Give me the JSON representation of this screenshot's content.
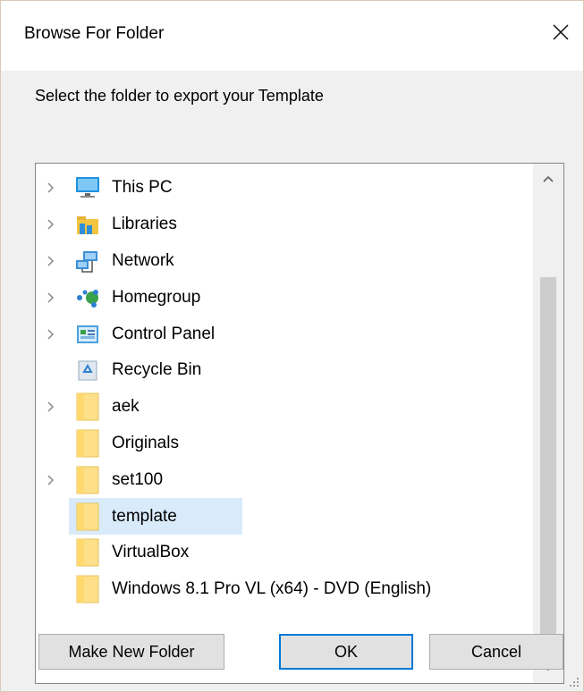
{
  "window": {
    "title": "Browse For Folder",
    "close_icon": "close-icon"
  },
  "prompt": "Select the folder to export your Template",
  "tree": {
    "items": [
      {
        "label": "This PC",
        "icon": "computer-icon",
        "expandable": true,
        "selected": false
      },
      {
        "label": "Libraries",
        "icon": "libraries-icon",
        "expandable": true,
        "selected": false
      },
      {
        "label": "Network",
        "icon": "network-icon",
        "expandable": true,
        "selected": false
      },
      {
        "label": "Homegroup",
        "icon": "homegroup-icon",
        "expandable": true,
        "selected": false
      },
      {
        "label": "Control Panel",
        "icon": "control-panel-icon",
        "expandable": true,
        "selected": false
      },
      {
        "label": "Recycle Bin",
        "icon": "recycle-bin-icon",
        "expandable": false,
        "selected": false
      },
      {
        "label": "aek",
        "icon": "folder-icon",
        "expandable": true,
        "selected": false
      },
      {
        "label": "Originals",
        "icon": "folder-icon",
        "expandable": false,
        "selected": false
      },
      {
        "label": "set100",
        "icon": "folder-icon",
        "expandable": true,
        "selected": false
      },
      {
        "label": "template",
        "icon": "folder-icon",
        "expandable": false,
        "selected": true
      },
      {
        "label": "VirtualBox",
        "icon": "folder-icon",
        "expandable": false,
        "selected": false
      },
      {
        "label": "Windows 8.1 Pro VL (x64) - DVD (English)",
        "icon": "folder-icon",
        "expandable": false,
        "selected": false
      }
    ]
  },
  "buttons": {
    "make_new_folder": "Make New Folder",
    "ok": "OK",
    "cancel": "Cancel"
  },
  "colors": {
    "selection": "#d9ebfb",
    "default_button_border": "#0078d7",
    "folder": "#ffd86e"
  }
}
